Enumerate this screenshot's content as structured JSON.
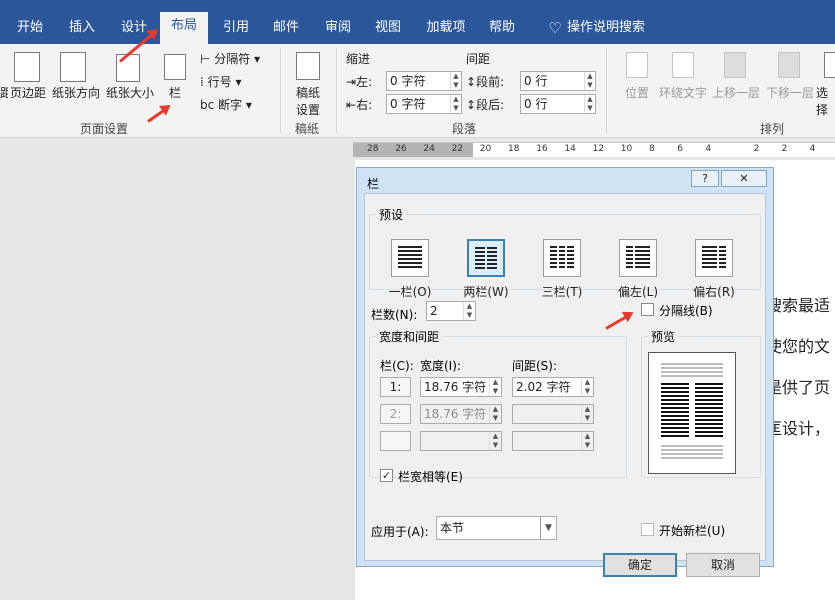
{
  "tabs": [
    "开始",
    "插入",
    "设计",
    "布局",
    "引用",
    "邮件",
    "审阅",
    "视图",
    "加载项",
    "帮助"
  ],
  "search_label": "操作说明搜索",
  "ribbon": {
    "page_setup": {
      "margins": "页边距",
      "orientation": "纸张方向",
      "size": "纸张大小",
      "columns": "栏",
      "breaks": "分隔符",
      "line_numbers": "行号",
      "hyphenation": "断字",
      "group": "页面设置",
      "left_clip": "距"
    },
    "manuscript": {
      "btn1": "稿纸",
      "btn2": "设置",
      "group": "稿纸"
    },
    "paragraph": {
      "indent": "缩进",
      "spacing": "间距",
      "left_label": "左:",
      "right_label": "右:",
      "left_value": "0 字符",
      "right_value": "0 字符",
      "before_label": "段前:",
      "after_label": "段后:",
      "before_value": "0 行",
      "after_value": "0 行",
      "group": "段落"
    },
    "arrange": {
      "position": "位置",
      "wrap": "环绕文字",
      "forward": "上移一层",
      "backward": "下移一层",
      "select": "选择",
      "group": "排列"
    }
  },
  "ruler_ticks": [
    "28",
    "26",
    "24",
    "22",
    "20",
    "18",
    "16",
    "14",
    "12",
    "10",
    "8",
    "6",
    "4",
    "2",
    "2",
    "4"
  ],
  "doc_lines": [
    "搜索最适",
    "使您的文",
    "是供了页",
    "匡设计，"
  ],
  "dialog": {
    "title": "栏",
    "help": "?",
    "close": "✕",
    "preset_label": "预设",
    "presets": [
      "一栏(O)",
      "两栏(W)",
      "三栏(T)",
      "偏左(L)",
      "偏右(R)"
    ],
    "columns_label": "栏数(N):",
    "columns_value": "2",
    "divider_label": "分隔线(B)",
    "width_spacing_label": "宽度和间距",
    "col_header": "栏(C):",
    "width_header": "宽度(I):",
    "spacing_header": "间距(S):",
    "rows": [
      {
        "num": "1:",
        "width": "18.76 字符",
        "spacing": "2.02 字符"
      },
      {
        "num": "2:",
        "width": "18.76 字符",
        "spacing": ""
      },
      {
        "num": "",
        "width": "",
        "spacing": ""
      }
    ],
    "equal_width_label": "栏宽相等(E)",
    "preview_label": "预览",
    "apply_label": "应用于(A):",
    "apply_value": "本节",
    "new_column_label": "开始新栏(U)",
    "ok": "确定",
    "cancel": "取消"
  }
}
